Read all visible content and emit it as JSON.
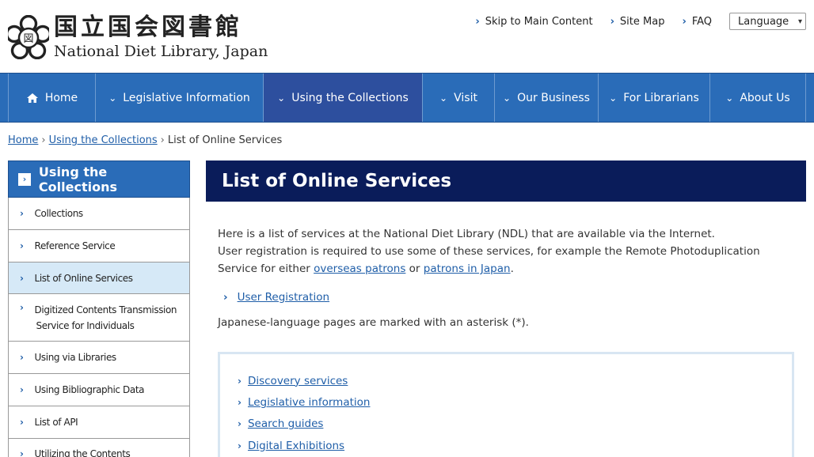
{
  "header": {
    "logo_jp": "国立国会図書館",
    "logo_en": "National Diet Library, Japan",
    "util_links": [
      "Skip to Main Content",
      "Site Map",
      "FAQ"
    ],
    "language_label": "Language"
  },
  "nav": {
    "items": [
      "Home",
      "Legislative Information",
      "Using the Collections",
      "Visit",
      "Our Business",
      "For Librarians",
      "About Us"
    ],
    "active": "Using the Collections"
  },
  "breadcrumb": {
    "home": "Home",
    "parent": "Using the Collections",
    "current": "List of Online Services"
  },
  "sidebar": {
    "heading": "Using the Collections",
    "items": [
      "Collections",
      "Reference Service",
      "List of Online Services",
      "Digitized Contents Transmission",
      "Service for Individuals",
      "Using via Libraries",
      "Using Bibliographic Data",
      "List of API",
      "Utilizing the Contents"
    ]
  },
  "main": {
    "title": "List of Online Services",
    "intro_line1": "Here is a list of services at the National Diet Library (NDL) that are available via the Internet.",
    "intro_line2": "User registration is required to use some of these services, for example the Remote Photoduplication",
    "intro_line3_pre": "Service for either ",
    "link_overseas": "overseas patrons",
    "intro_or": " or ",
    "link_japan": "patrons in Japan",
    "intro_end": ".",
    "registration_link": "User Registration",
    "note": "Japanese-language pages are marked with an asterisk (*).",
    "toc": [
      "Discovery services",
      "Legislative information",
      "Search guides",
      "Digital Exhibitions"
    ]
  },
  "colors": {
    "nav_bg": "#2a6cb8",
    "nav_active": "#2d4f9e",
    "title_bg": "#0a1c5a",
    "link": "#1f5ea8",
    "sidebar_active": "#d6e9f7"
  }
}
